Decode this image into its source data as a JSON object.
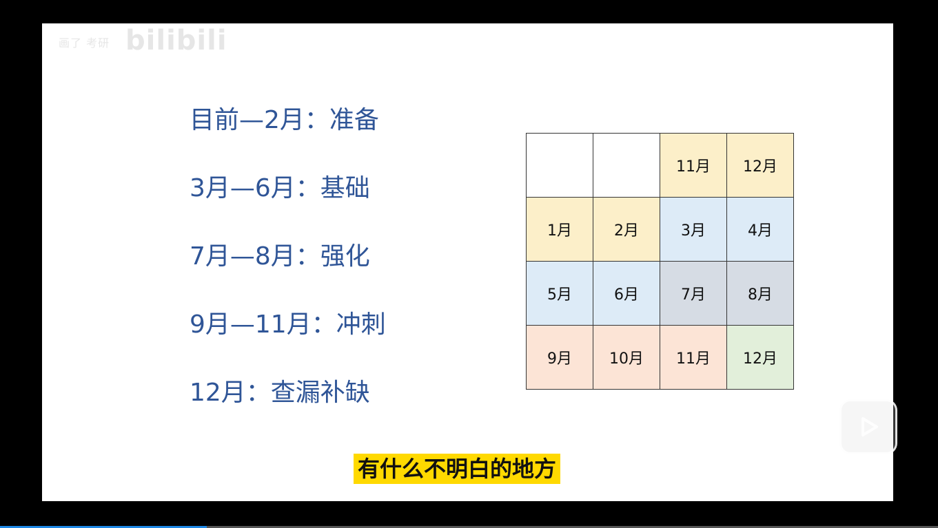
{
  "watermark": {
    "small_text": "画了 考研",
    "brand": "bilibili"
  },
  "plan": [
    {
      "label": "目前—2月：准备"
    },
    {
      "label": "3月—6月：基础"
    },
    {
      "label": "7月—8月：强化"
    },
    {
      "label": "9月—11月：冲刺"
    },
    {
      "label": "12月：查漏补缺"
    }
  ],
  "calendar": {
    "cells": [
      {
        "label": "",
        "color": "#ffffff"
      },
      {
        "label": "",
        "color": "#ffffff"
      },
      {
        "label": "11月",
        "color": "#fcefc9"
      },
      {
        "label": "12月",
        "color": "#fcefc9"
      },
      {
        "label": "1月",
        "color": "#fcefc9"
      },
      {
        "label": "2月",
        "color": "#fcefc9"
      },
      {
        "label": "3月",
        "color": "#ddebf7"
      },
      {
        "label": "4月",
        "color": "#ddebf7"
      },
      {
        "label": "5月",
        "color": "#ddebf7"
      },
      {
        "label": "6月",
        "color": "#ddebf7"
      },
      {
        "label": "7月",
        "color": "#d6dce4"
      },
      {
        "label": "8月",
        "color": "#d6dce4"
      },
      {
        "label": "9月",
        "color": "#fce4d6"
      },
      {
        "label": "10月",
        "color": "#fce4d6"
      },
      {
        "label": "11月",
        "color": "#fce4d6"
      },
      {
        "label": "12月",
        "color": "#e2efda"
      }
    ]
  },
  "subtitle": "有什么不明白的地方",
  "colors": {
    "plan_text": "#2f5597",
    "subtitle_bg": "#ffd900",
    "progress": "#1e88e5"
  },
  "icons": {
    "play": "play-icon"
  }
}
